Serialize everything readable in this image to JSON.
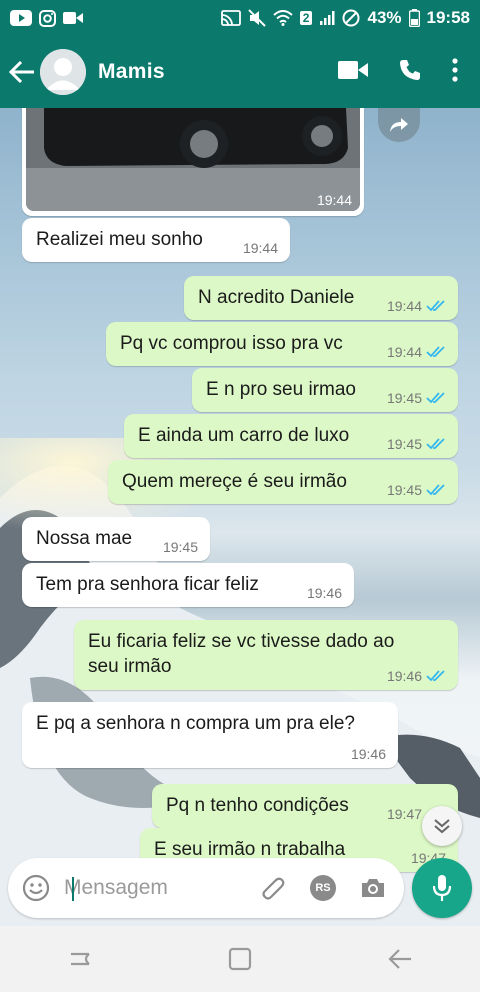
{
  "status_bar": {
    "battery": "43%",
    "time": "19:58",
    "sim_slot": "2",
    "left_icons": [
      "youtube-icon",
      "instagram-icon",
      "video-icon"
    ],
    "right_icons": [
      "cast-icon",
      "mute-icon",
      "wifi-icon",
      "signal-icon",
      "dnd-icon",
      "battery-icon"
    ]
  },
  "header": {
    "contact_name": "Mamis",
    "actions": [
      "video-call-icon",
      "call-icon",
      "more-icon"
    ]
  },
  "chat": {
    "image_message": {
      "time": "19:44"
    },
    "messages": [
      {
        "dir": "in",
        "text": "Realizei meu sonho",
        "time": "19:44"
      },
      {
        "dir": "out",
        "text": "N acredito Daniele",
        "time": "19:44",
        "read": true
      },
      {
        "dir": "out",
        "text": "Pq vc comprou isso pra vc",
        "time": "19:44",
        "read": true
      },
      {
        "dir": "out",
        "text": "E n pro seu irmao",
        "time": "19:45",
        "read": true
      },
      {
        "dir": "out",
        "text": "E ainda um carro de luxo",
        "time": "19:45",
        "read": true
      },
      {
        "dir": "out",
        "text": "Quem mereçe é seu irmão",
        "time": "19:45",
        "read": true
      },
      {
        "dir": "in",
        "text": "Nossa mae",
        "time": "19:45"
      },
      {
        "dir": "in",
        "text": "Tem pra senhora ficar feliz",
        "time": "19:46"
      },
      {
        "dir": "out",
        "text": "Eu ficaria feliz se vc tivesse dado ao",
        "text2": "seu irmão",
        "time": "19:46",
        "read": true
      },
      {
        "dir": "in",
        "text": "E pq a senhora n compra um pra ele?",
        "time": "19:46"
      },
      {
        "dir": "out",
        "text": "Pq n tenho condições",
        "time": "19:47",
        "read": true
      },
      {
        "dir": "out",
        "text": "E seu irmão  n trabalha",
        "time": "19:47",
        "read": true
      }
    ]
  },
  "input": {
    "placeholder": "Mensagem",
    "badge": "RS"
  },
  "colors": {
    "brand": "#0b7a6d",
    "outgoing": "#dcf8c6",
    "incoming": "#ffffff",
    "read_ticks": "#34b7f1",
    "mic": "#17a68a"
  }
}
